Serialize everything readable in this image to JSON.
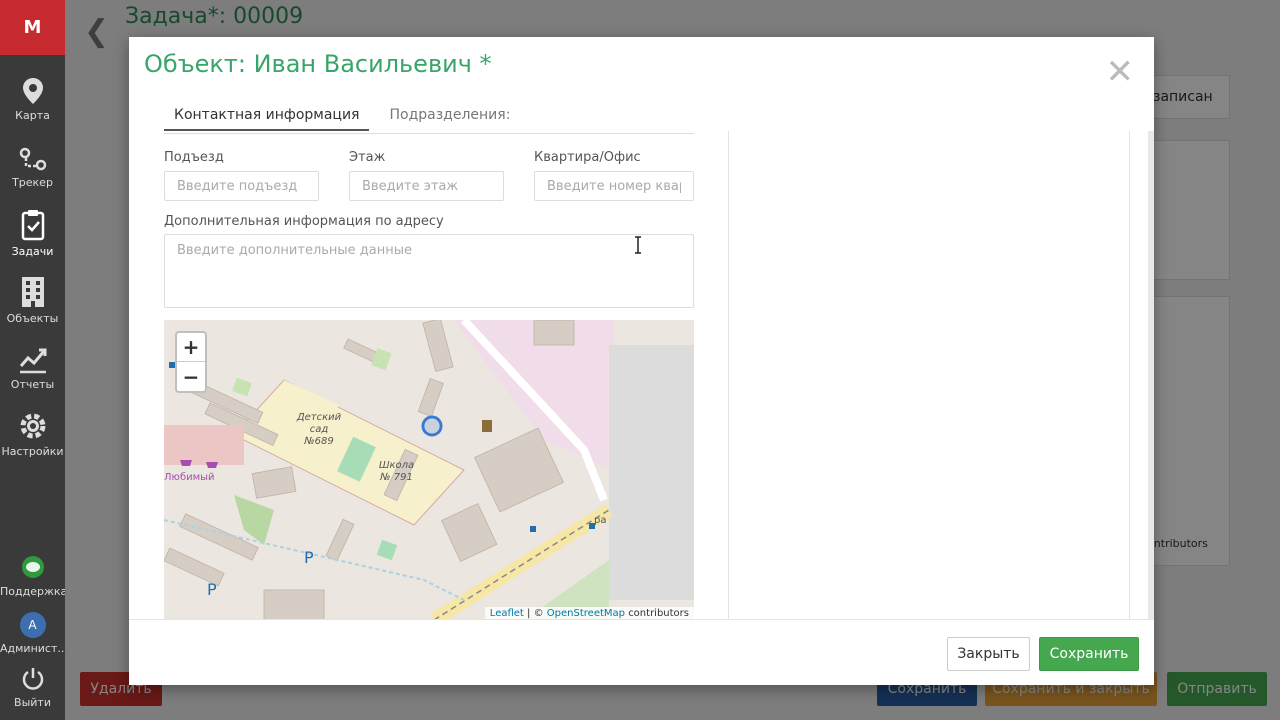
{
  "sidebar": {
    "logo": "M",
    "items": [
      {
        "label": "Карта",
        "icon": "map-pin-icon"
      },
      {
        "label": "Трекер",
        "icon": "route-icon"
      },
      {
        "label": "Задачи",
        "icon": "clipboard-check-icon"
      },
      {
        "label": "Объекты",
        "icon": "building-icon"
      },
      {
        "label": "Отчеты",
        "icon": "chart-icon"
      },
      {
        "label": "Настройки",
        "icon": "gear-icon"
      }
    ],
    "support_label": "Поддержка",
    "admin_avatar": "A",
    "admin_label": "Админист...",
    "exit_label": "Выйти"
  },
  "background": {
    "title": "Задача*: 00009",
    "tab_partial": "записан",
    "map_attribution_partial": "contributors",
    "buttons": {
      "delete": "Удалить",
      "save": "Сохранить",
      "save_close": "Сохранить и закрыть",
      "send": "Отправить"
    }
  },
  "modal": {
    "title": "Объект: Иван Васильевич *",
    "tabs": [
      "Контактная информация",
      "Подразделения:"
    ],
    "active_tab": 0,
    "fields": {
      "entrance": {
        "label": "Подъезд",
        "placeholder": "Введите подъезд",
        "value": ""
      },
      "floor": {
        "label": "Этаж",
        "placeholder": "Введите этаж",
        "value": ""
      },
      "apartment": {
        "label": "Квартира/Офис",
        "placeholder": "Введите номер квартиры",
        "value": ""
      },
      "extra": {
        "label": "Дополнительная информация по адресу",
        "placeholder": "Введите дополнительные данные",
        "value": ""
      }
    },
    "map": {
      "zoom_in": "+",
      "zoom_out": "−",
      "attribution_leaflet": "Leaflet",
      "attribution_sep": "| ©",
      "attribution_osm": "OpenStreetMap",
      "attribution_rest": "contributors",
      "labels": {
        "kindergarten": "Детский сад №689",
        "school": "Школа № 791",
        "shop": "Любимый",
        "parking": "P",
        "road": "ра"
      }
    },
    "footer": {
      "close": "Закрыть",
      "save": "Сохранить"
    }
  }
}
